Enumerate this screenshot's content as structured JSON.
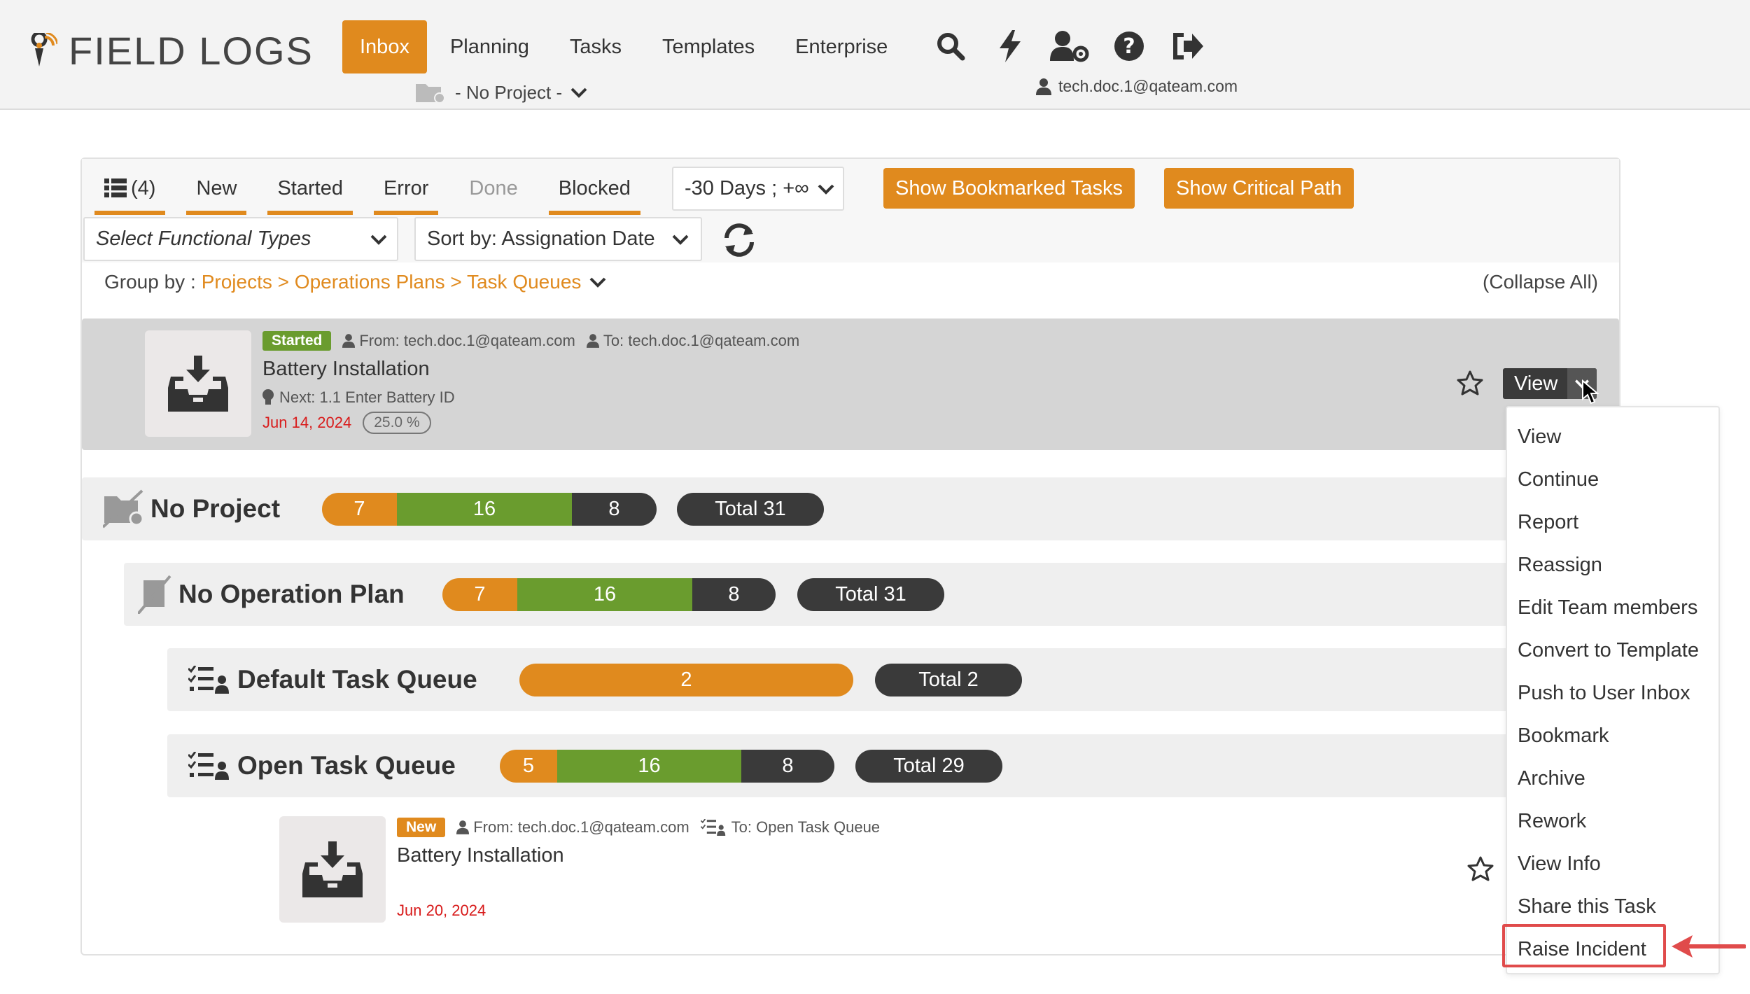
{
  "app": {
    "name": "FIELD LOGS"
  },
  "nav": {
    "items": [
      {
        "label": "Inbox",
        "active": true
      },
      {
        "label": "Planning"
      },
      {
        "label": "Tasks"
      },
      {
        "label": "Templates"
      },
      {
        "label": "Enterprise"
      }
    ],
    "icons": [
      "search-icon",
      "lightning-icon",
      "user-settings-icon",
      "help-icon",
      "logout-icon"
    ],
    "project_select": "- No Project -",
    "user": "tech.doc.1@qateam.com"
  },
  "toolbar": {
    "tabs": [
      {
        "label": "(4)",
        "icon": "list-icon"
      },
      {
        "label": "New"
      },
      {
        "label": "Started"
      },
      {
        "label": "Error"
      },
      {
        "label": "Done"
      },
      {
        "label": "Blocked"
      }
    ],
    "date_range": "-30 Days ; +∞",
    "show_bookmarked": "Show Bookmarked Tasks",
    "show_critical": "Show Critical Path",
    "functional_types_placeholder": "Select Functional Types",
    "sort_by": "Sort by: Assignation Date"
  },
  "groupby": {
    "label": "Group by :",
    "path": "Projects > Operations Plans > Task Queues",
    "collapse_all": "(Collapse All)"
  },
  "task1": {
    "status": "Started",
    "from": "From: tech.doc.1@qateam.com",
    "to": "To: tech.doc.1@qateam.com",
    "title": "Battery Installation",
    "next": "Next: 1.1 Enter Battery ID",
    "date": "Jun 14, 2024",
    "progress": "25.0 %",
    "view_label": "View"
  },
  "groups": {
    "project": {
      "title": "No Project",
      "seg1": "7",
      "seg2": "16",
      "seg3": "8",
      "total": "Total 31"
    },
    "plan": {
      "title": "No Operation Plan",
      "seg1": "7",
      "seg2": "16",
      "seg3": "8",
      "total": "Total 31"
    },
    "default_queue": {
      "title": "Default Task Queue",
      "seg1": "2",
      "total": "Total 2"
    },
    "open_queue": {
      "title": "Open Task Queue",
      "seg1": "5",
      "seg2": "16",
      "seg3": "8",
      "total": "Total 29"
    }
  },
  "task2": {
    "status": "New",
    "from": "From: tech.doc.1@qateam.com",
    "to": "To: Open Task Queue",
    "title": "Battery Installation",
    "date": "Jun 20, 2024"
  },
  "dropdown": {
    "items": [
      "View",
      "Continue",
      "Report",
      "Reassign",
      "Edit Team members",
      "Convert to Template",
      "Push to User Inbox",
      "Bookmark",
      "Archive",
      "Rework",
      "View Info",
      "Share this Task",
      "Raise Incident"
    ]
  },
  "colors": {
    "orange": "#e08a1e",
    "green": "#6a9c2e",
    "dark": "#3a3a3a",
    "red_date": "#d81c1c",
    "highlight": "#e04b4b"
  }
}
